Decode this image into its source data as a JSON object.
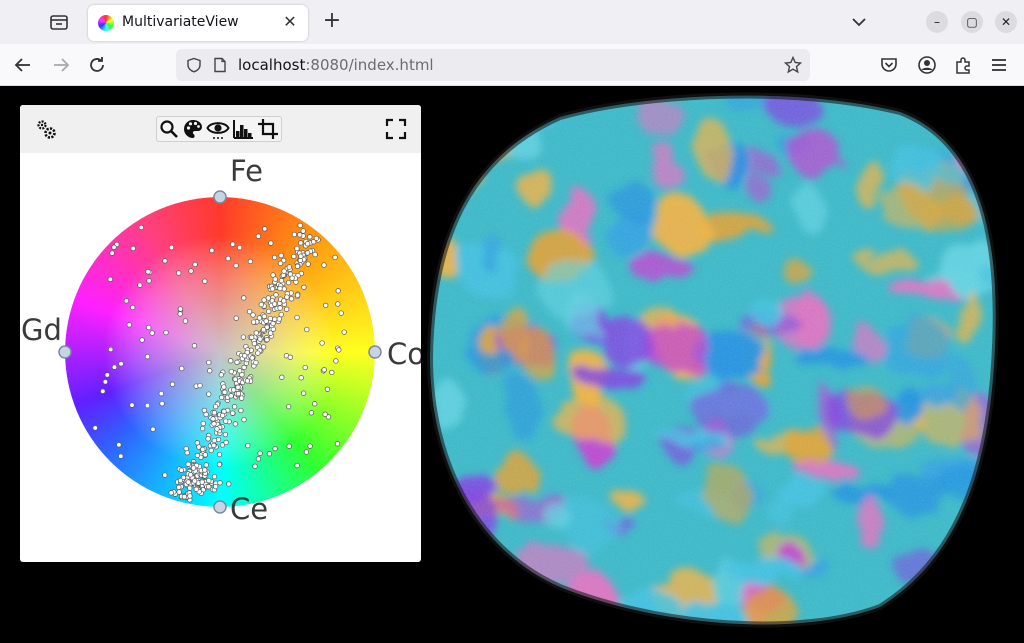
{
  "browser": {
    "tab": {
      "title": "MultivariateView",
      "close_symbol": "✕"
    },
    "new_tab_symbol": "+",
    "window_controls": {
      "minimize": "–",
      "maximize": "▢",
      "close": "✕"
    },
    "url": {
      "host": "localhost",
      "rest": ":8080/index.html"
    }
  },
  "panel": {
    "toolbar": {
      "settings_icon": "gears-icon",
      "tools": [
        "zoom-icon",
        "palette-icon",
        "eye-icon",
        "histogram-icon",
        "crop-icon"
      ],
      "fullscreen_icon": "fullscreen-icon"
    },
    "plot": {
      "anchors": [
        {
          "label": "Fe",
          "angle_deg": 90,
          "color": "#ff2a2a"
        },
        {
          "label": "Co",
          "angle_deg": 0,
          "color": "#ffff00"
        },
        {
          "label": "Ce",
          "angle_deg": 270,
          "color": "#00ffff"
        },
        {
          "label": "Gd",
          "angle_deg": 180,
          "color": "#ff00ff"
        }
      ],
      "point_count": 520
    }
  },
  "colors": {
    "tabbar_bg": "#f0f0f4",
    "navbar_bg": "#f9f9fb",
    "anchor_fill": "#c8d4e6",
    "point_fill": "#ffffff"
  }
}
